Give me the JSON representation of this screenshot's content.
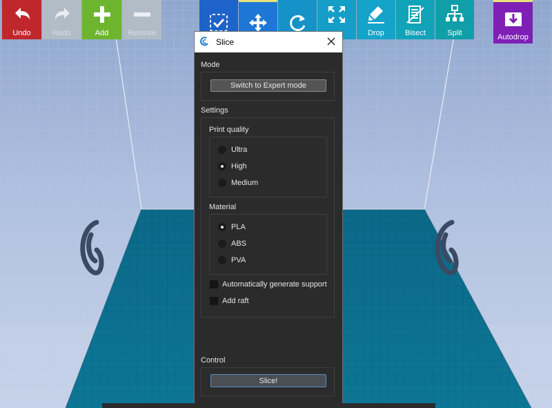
{
  "toolbar": {
    "left": [
      {
        "label": "Undo",
        "icon": "undo-arrow-icon",
        "color": "#c0272d",
        "enabled": true
      },
      {
        "label": "Redo",
        "icon": "redo-arrow-icon",
        "color": "#b2bcc6",
        "enabled": false
      },
      {
        "label": "Add",
        "icon": "plus-icon",
        "color": "#6db52f",
        "enabled": true
      },
      {
        "label": "Remove",
        "icon": "minus-icon",
        "color": "#b2bcc6",
        "enabled": false
      }
    ],
    "tools": [
      {
        "label": "",
        "icon": "select-check-icon",
        "color": "#1e63c9"
      },
      {
        "label": "",
        "icon": "move-arrows-icon",
        "color": "#1e77d6"
      },
      {
        "label": "",
        "icon": "rotate-icon",
        "color": "#1593c8"
      },
      {
        "label": "e",
        "icon": "scale-expand-icon",
        "color": "#159ec8"
      },
      {
        "label": "Drop",
        "icon": "drop-pen-icon",
        "color": "#14a3c9"
      },
      {
        "label": "Bisect",
        "icon": "bisect-icon",
        "color": "#11a3b8"
      },
      {
        "label": "Split",
        "icon": "split-tree-icon",
        "color": "#109fa8"
      }
    ],
    "autodrop": {
      "label": "Autodrop",
      "icon": "autodrop-icon",
      "color": "#7f1fb5"
    }
  },
  "dialog": {
    "title": "Slice",
    "mode": {
      "title": "Mode",
      "button": "Switch to Expert mode"
    },
    "settings": {
      "title": "Settings",
      "print_quality": {
        "title": "Print quality",
        "options": [
          "Ultra",
          "High",
          "Medium"
        ],
        "selected": "High"
      },
      "material": {
        "title": "Material",
        "options": [
          "PLA",
          "ABS",
          "PVA"
        ],
        "selected": "PLA"
      },
      "support_label": "Automatically generate support",
      "support_checked": false,
      "raft_label": "Add raft",
      "raft_checked": false
    },
    "control": {
      "title": "Control",
      "button": "Slice!"
    }
  },
  "colors": {
    "bed": "#0b6e8c",
    "dialog_bg": "#2b2b2b",
    "accent_border": "#5c8fc8"
  }
}
